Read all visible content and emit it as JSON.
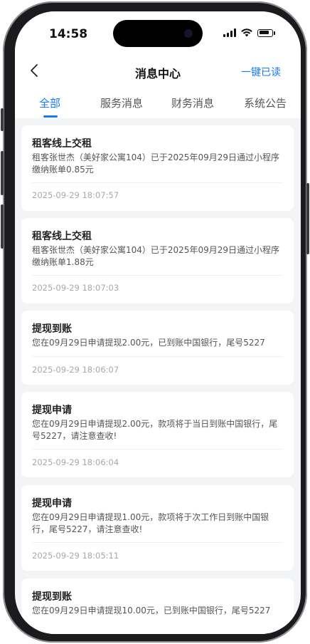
{
  "status_bar": {
    "time": "14:58"
  },
  "header": {
    "title": "消息中心",
    "read_all_label": "一键已读"
  },
  "tabs": [
    {
      "label": "全部",
      "active": true
    },
    {
      "label": "服务消息",
      "active": false
    },
    {
      "label": "财务消息",
      "active": false
    },
    {
      "label": "系统公告",
      "active": false
    }
  ],
  "messages": [
    {
      "title": "租客线上交租",
      "content": "租客张世杰（美好家公寓104）已于2025年09月29日通过小程序缴纳账单0.85元",
      "time": "2025-09-29 18:07:57"
    },
    {
      "title": "租客线上交租",
      "content": "租客张世杰（美好家公寓104）已于2025年09月29日通过小程序缴纳账单1.88元",
      "time": "2025-09-29 18:07:03"
    },
    {
      "title": "提现到账",
      "content": "您在09月29日申请提现2.00元，已到账中国银行，尾号5227",
      "time": "2025-09-29 18:06:07"
    },
    {
      "title": "提现申请",
      "content": "您在09月29日申请提现2.00元，款项将于当日到账中国银行，尾号5227，请注意查收!",
      "time": "2025-09-29 18:06:04"
    },
    {
      "title": "提现申请",
      "content": "您在09月29日申请提现1.00元，款项将于次工作日到账中国银行，尾号5227，请注意查收!",
      "time": "2025-09-29 18:05:11"
    },
    {
      "title": "提现到账",
      "content": "您在09月29日申请提现10.00元，已到账中国银行，尾号5227",
      "time": ""
    }
  ],
  "colors": {
    "accent": "#1677ff",
    "background": "#f3f4f6",
    "card": "#ffffff"
  }
}
